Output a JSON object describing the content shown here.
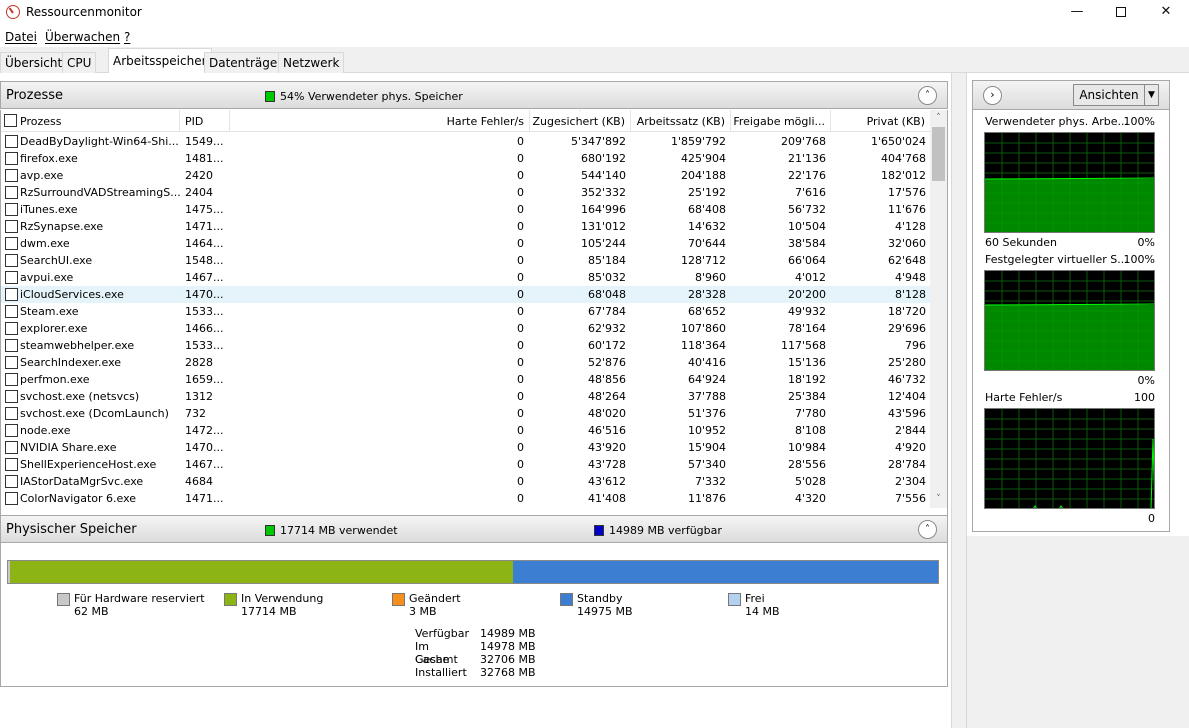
{
  "window": {
    "title": "Ressourcenmonitor",
    "min": "—",
    "close": "✕"
  },
  "menu": {
    "datei": "Datei",
    "ueberwachen": "Überwachen",
    "help": "?"
  },
  "tabs": [
    "Übersicht",
    "CPU",
    "Arbeitsspeicher",
    "Datenträger",
    "Netzwerk"
  ],
  "processes": {
    "title": "Prozesse",
    "memory_note": "54% Verwendeter phys. Speicher",
    "columns": [
      "Prozess",
      "PID",
      "Harte Fehler/s",
      "Zugesichert (KB)",
      "Arbeitssatz (KB)",
      "Freigabe mögli...",
      "Privat (KB)"
    ],
    "rows": [
      [
        "DeadByDaylight-Win64-Shi...",
        "1549...",
        "0",
        "5'347'892",
        "1'859'792",
        "209'768",
        "1'650'024"
      ],
      [
        "firefox.exe",
        "1481...",
        "0",
        "680'192",
        "425'904",
        "21'136",
        "404'768"
      ],
      [
        "avp.exe",
        "2420",
        "0",
        "544'140",
        "204'188",
        "22'176",
        "182'012"
      ],
      [
        "RzSurroundVADStreamingS...",
        "2404",
        "0",
        "352'332",
        "25'192",
        "7'616",
        "17'576"
      ],
      [
        "iTunes.exe",
        "1475...",
        "0",
        "164'996",
        "68'408",
        "56'732",
        "11'676"
      ],
      [
        "RzSynapse.exe",
        "1471...",
        "0",
        "131'012",
        "14'632",
        "10'504",
        "4'128"
      ],
      [
        "dwm.exe",
        "1464...",
        "0",
        "105'244",
        "70'644",
        "38'584",
        "32'060"
      ],
      [
        "SearchUI.exe",
        "1548...",
        "0",
        "85'184",
        "128'712",
        "66'064",
        "62'648"
      ],
      [
        "avpui.exe",
        "1467...",
        "0",
        "85'032",
        "8'960",
        "4'012",
        "4'948"
      ],
      [
        "iCloudServices.exe",
        "1470...",
        "0",
        "68'048",
        "28'328",
        "20'200",
        "8'128"
      ],
      [
        "Steam.exe",
        "1533...",
        "0",
        "67'784",
        "68'652",
        "49'932",
        "18'720"
      ],
      [
        "explorer.exe",
        "1466...",
        "0",
        "62'932",
        "107'860",
        "78'164",
        "29'696"
      ],
      [
        "steamwebhelper.exe",
        "1533...",
        "0",
        "60'172",
        "118'364",
        "117'568",
        "796"
      ],
      [
        "SearchIndexer.exe",
        "2828",
        "0",
        "52'876",
        "40'416",
        "15'136",
        "25'280"
      ],
      [
        "perfmon.exe",
        "1659...",
        "0",
        "48'856",
        "64'924",
        "18'192",
        "46'732"
      ],
      [
        "svchost.exe (netsvcs)",
        "1312",
        "0",
        "48'264",
        "37'788",
        "25'384",
        "12'404"
      ],
      [
        "svchost.exe (DcomLaunch)",
        "732",
        "0",
        "48'020",
        "51'376",
        "7'780",
        "43'596"
      ],
      [
        "node.exe",
        "1472...",
        "0",
        "46'516",
        "10'952",
        "8'108",
        "2'844"
      ],
      [
        "NVIDIA Share.exe",
        "1470...",
        "0",
        "43'920",
        "15'904",
        "10'984",
        "4'920"
      ],
      [
        "ShellExperienceHost.exe",
        "1467...",
        "0",
        "43'728",
        "57'340",
        "28'556",
        "28'784"
      ],
      [
        "IAStorDataMgrSvc.exe",
        "4684",
        "0",
        "43'612",
        "7'332",
        "5'028",
        "2'304"
      ],
      [
        "ColorNavigator 6.exe",
        "1471...",
        "0",
        "41'408",
        "11'876",
        "4'320",
        "7'556"
      ]
    ]
  },
  "physical": {
    "title": "Physischer Speicher",
    "used_note": "17714 MB verwendet",
    "available_note": "14989 MB verfügbar",
    "segments": [
      {
        "name": "Für Hardware reserviert",
        "value": "62 MB",
        "mb": 62,
        "color": "#c8c8c8"
      },
      {
        "name": "In Verwendung",
        "value": "17714 MB",
        "mb": 17714,
        "color": "#8cb414"
      },
      {
        "name": "Geändert",
        "value": "3 MB",
        "mb": 3,
        "color": "#f5901e"
      },
      {
        "name": "Standby",
        "value": "14975 MB",
        "mb": 14975,
        "color": "#3c7ed2"
      },
      {
        "name": "Frei",
        "value": "14 MB",
        "mb": 14,
        "color": "#b4d2f0"
      }
    ],
    "stats": [
      [
        "Verfügbar",
        "14989 MB"
      ],
      [
        "Im Cache",
        "14978 MB"
      ],
      [
        "Gesamt",
        "32706 MB"
      ],
      [
        "Installiert",
        "32768 MB"
      ]
    ]
  },
  "graphs": {
    "views_label": "Ansichten",
    "g1": {
      "title": "Verwendeter phys. Arbe...",
      "max": "100%",
      "foot_left": "60 Sekunden",
      "foot_right": "0%",
      "level": 0.54
    },
    "g2": {
      "title": "Festgelegter virtueller S...",
      "max": "100%",
      "foot_right": "0%",
      "level": 0.66
    },
    "g3": {
      "title": "Harte Fehler/s",
      "max": "100",
      "foot_right": "0"
    }
  },
  "colors": {
    "graph_fill": "#00a000",
    "graph_line": "#00ff00",
    "grid": "#0a5a0a",
    "used_square": "#00c800",
    "avail_square": "#0000c8"
  }
}
